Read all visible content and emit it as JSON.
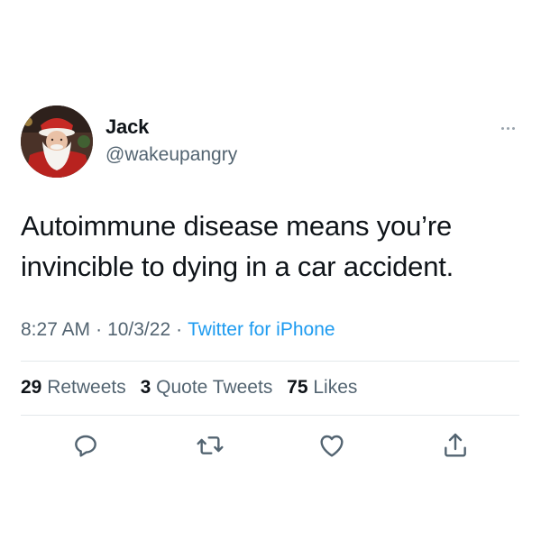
{
  "user": {
    "display_name": "Jack",
    "handle": "@wakeupangry",
    "avatar": "santa-claus-photo"
  },
  "tweet": {
    "text": "Autoimmune disease means you’re invincible to dying in a car accident."
  },
  "meta": {
    "time": "8:27 AM",
    "separator_1": "·",
    "date": "10/3/22",
    "separator_2": "·",
    "source": "Twitter for iPhone"
  },
  "stats": {
    "retweets_count": "29",
    "retweets_label": "Retweets",
    "quote_tweets_count": "3",
    "quote_tweets_label": "Quote Tweets",
    "likes_count": "75",
    "likes_label": "Likes"
  },
  "actions": {
    "reply_icon": "reply-icon",
    "retweet_icon": "retweet-icon",
    "like_icon": "heart-icon",
    "share_icon": "share-icon",
    "more_icon": "more-dots-icon"
  },
  "colors": {
    "text": "#0f1419",
    "secondary": "#536471",
    "link": "#1d9bf0",
    "divider": "#e4e8eb"
  }
}
